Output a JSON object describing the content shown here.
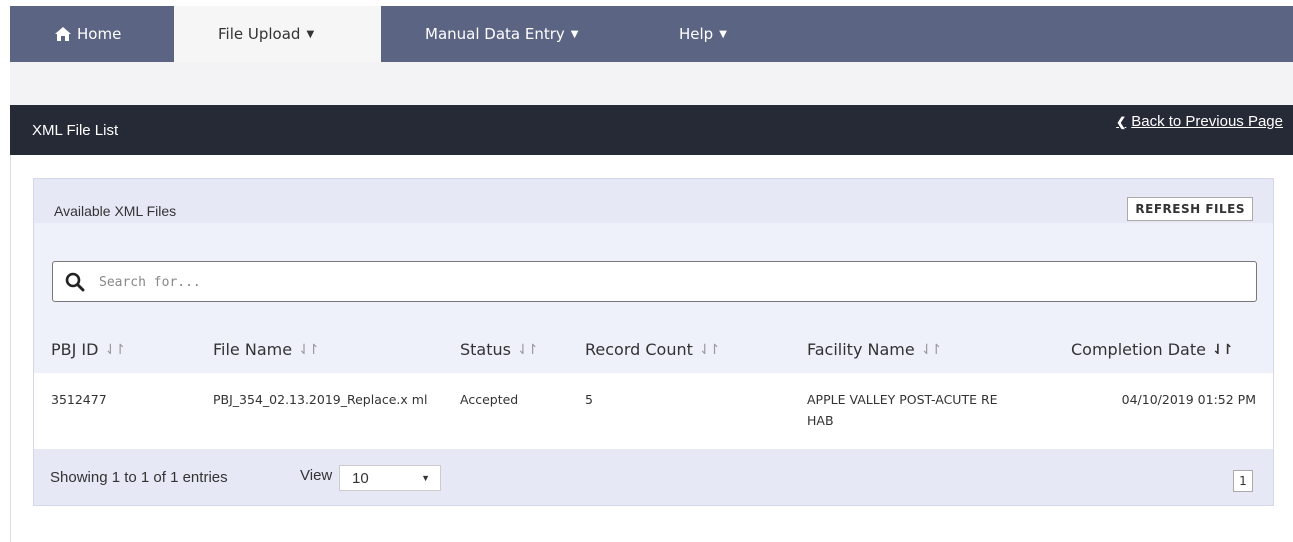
{
  "nav": {
    "home": "Home",
    "file_upload": "File Upload",
    "manual_data_entry": "Manual Data Entry",
    "help": "Help"
  },
  "header": {
    "title": "XML File List",
    "back_link": "Back to Previous Page"
  },
  "panel": {
    "title": "Available XML Files",
    "refresh_label": "REFRESH FILES",
    "search_placeholder": "Search for...",
    "columns": [
      "PBJ ID",
      "File Name",
      "Status",
      "Record Count",
      "Facility Name",
      "Completion Date"
    ],
    "rows": [
      {
        "pbj_id": "3512477",
        "file_name": "PBJ_354_02.13.2019_Replace.x ml",
        "status": "Accepted",
        "record_count": "5",
        "facility_name": "APPLE VALLEY POST-ACUTE RE HAB",
        "completion_date": "04/10/2019 01:52 PM"
      }
    ],
    "showing_text": "Showing 1 to 1 of 1 entries",
    "view_label": "View",
    "view_value": "10",
    "page": "1"
  },
  "colors": {
    "nav_bg": "#5c6484",
    "title_bar_bg": "#262a36",
    "panel_bg": "#e6e8f6"
  }
}
